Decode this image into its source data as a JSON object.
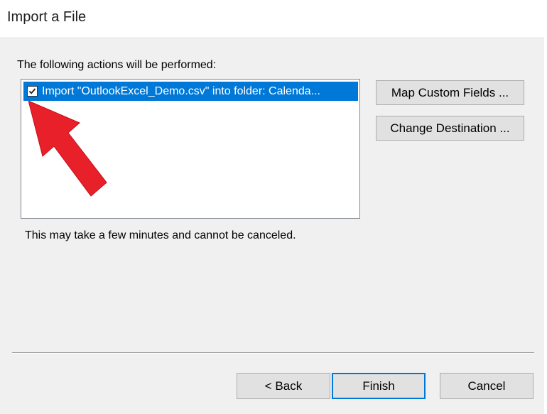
{
  "window": {
    "title": "Import a File"
  },
  "main": {
    "actions_label": "The following actions will be performed:",
    "actions": [
      {
        "checked": true,
        "label": "Import \"OutlookExcel_Demo.csv\" into folder: Calenda...",
        "selected": true
      }
    ],
    "notice": "This may take a few minutes and cannot be canceled."
  },
  "side_buttons": {
    "map_custom_fields": "Map Custom Fields ...",
    "change_destination": "Change Destination ..."
  },
  "footer": {
    "back": "< Back",
    "finish": "Finish",
    "cancel": "Cancel"
  },
  "colors": {
    "selection": "#0078d7",
    "annotation_arrow": "#e8202a",
    "dialog_background": "#f0f0f0"
  },
  "annotation": {
    "icon": "red-arrow-pointer-icon"
  }
}
